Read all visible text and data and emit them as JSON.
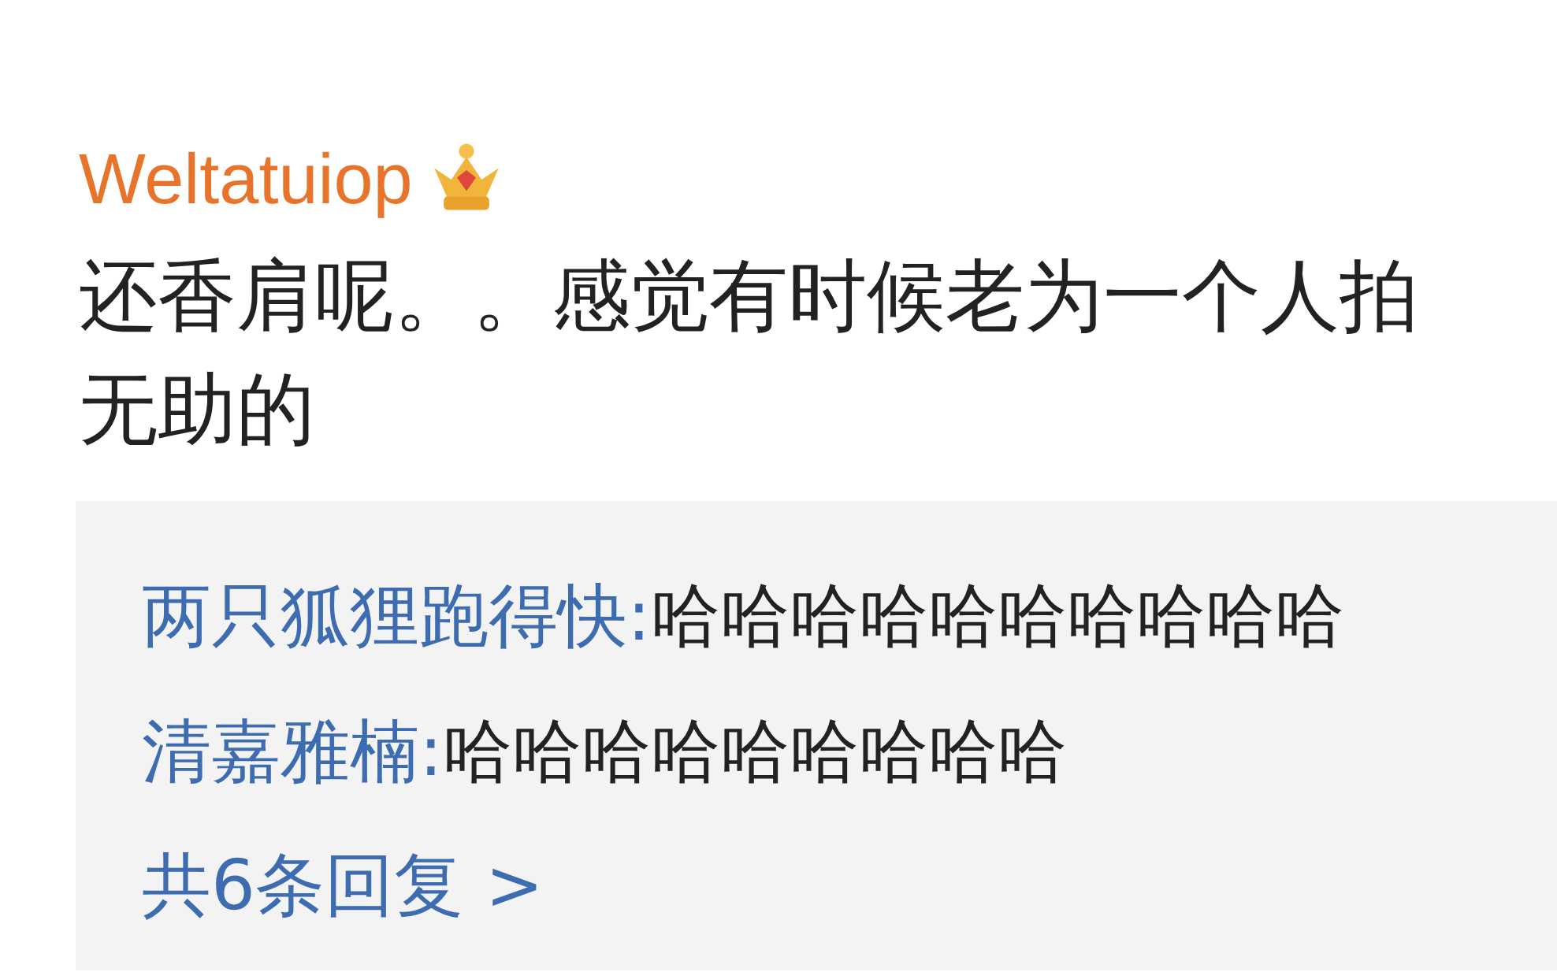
{
  "comment": {
    "author": "Weltatuiop",
    "badge": {
      "kind": "crown"
    },
    "text_lines": [
      "还香肩呢。。感觉有时候老为一个人拍",
      "无助的"
    ],
    "replies": [
      {
        "author": "两只狐狸跑得快:",
        "text": "哈哈哈哈哈哈哈哈哈哈"
      },
      {
        "author": "清嘉雅楠:",
        "text": "哈哈哈哈哈哈哈哈哈"
      }
    ],
    "more_replies": "共6条回复 >"
  }
}
